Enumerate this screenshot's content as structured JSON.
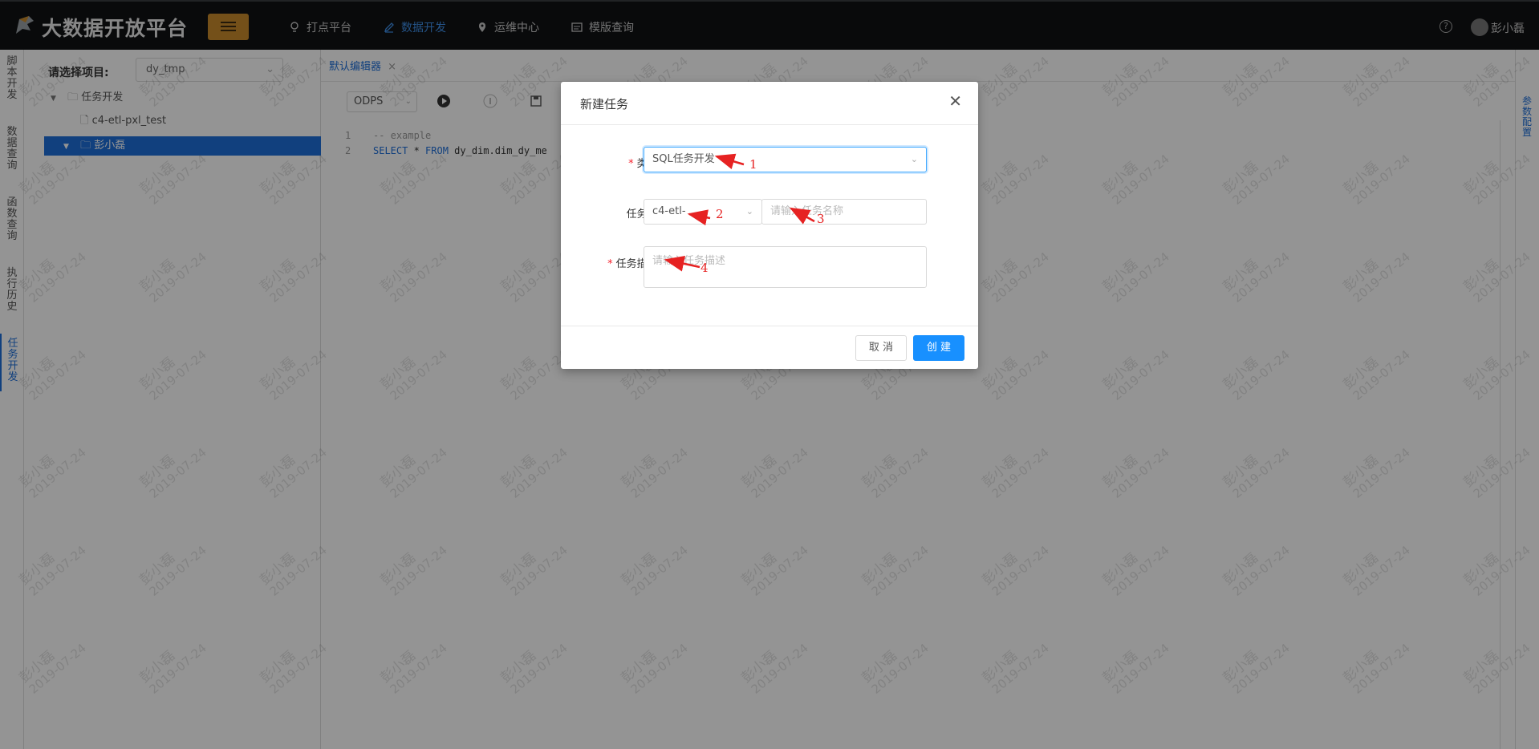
{
  "header": {
    "brand": "大数据开放平台",
    "nav": [
      {
        "label": "打点平台",
        "icon": "bulb-icon"
      },
      {
        "label": "数据开发",
        "icon": "edit-icon",
        "active": true
      },
      {
        "label": "运维中心",
        "icon": "location-icon"
      },
      {
        "label": "模版查询",
        "icon": "template-icon"
      }
    ],
    "user": "彭小磊"
  },
  "left_tabs": [
    "脚本开发",
    "数据查询",
    "函数查询",
    "执行历史",
    "任务开发"
  ],
  "file_panel": {
    "project_label": "请选择项目:",
    "project_value": "dy_tmp",
    "tree": [
      {
        "label": "任务开发",
        "icon": "folder-icon",
        "expanded": true
      },
      {
        "label": "c4-etl-pxl_test",
        "icon": "file-icon"
      },
      {
        "label": "彭小磊",
        "icon": "folder-icon",
        "selected": true
      }
    ]
  },
  "editor": {
    "tab": "默认编辑器",
    "engine": "ODPS",
    "lines": [
      {
        "no": "1",
        "text": "-- example"
      },
      {
        "no": "2",
        "kw1": "SELECT",
        "mid": " * ",
        "kw2": "FROM",
        "rest": " dy_dim.dim_dy_me"
      }
    ]
  },
  "right_tab": "参数配置",
  "watermark": {
    "name": "彭小磊",
    "date": "2019-07-24"
  },
  "modal": {
    "title": "新建任务",
    "fields": {
      "type_label": "类型:",
      "type_value": "SQL任务开发",
      "name_label": "任务名:",
      "name_prefix": "c4-etl-",
      "name_placeholder": "请输入任务名称",
      "desc_label": "任务描述:",
      "desc_placeholder": "请输入任务描述"
    },
    "cancel_label": "取 消",
    "ok_label": "创 建"
  },
  "annotations": [
    "1",
    "2",
    "3",
    "4"
  ]
}
